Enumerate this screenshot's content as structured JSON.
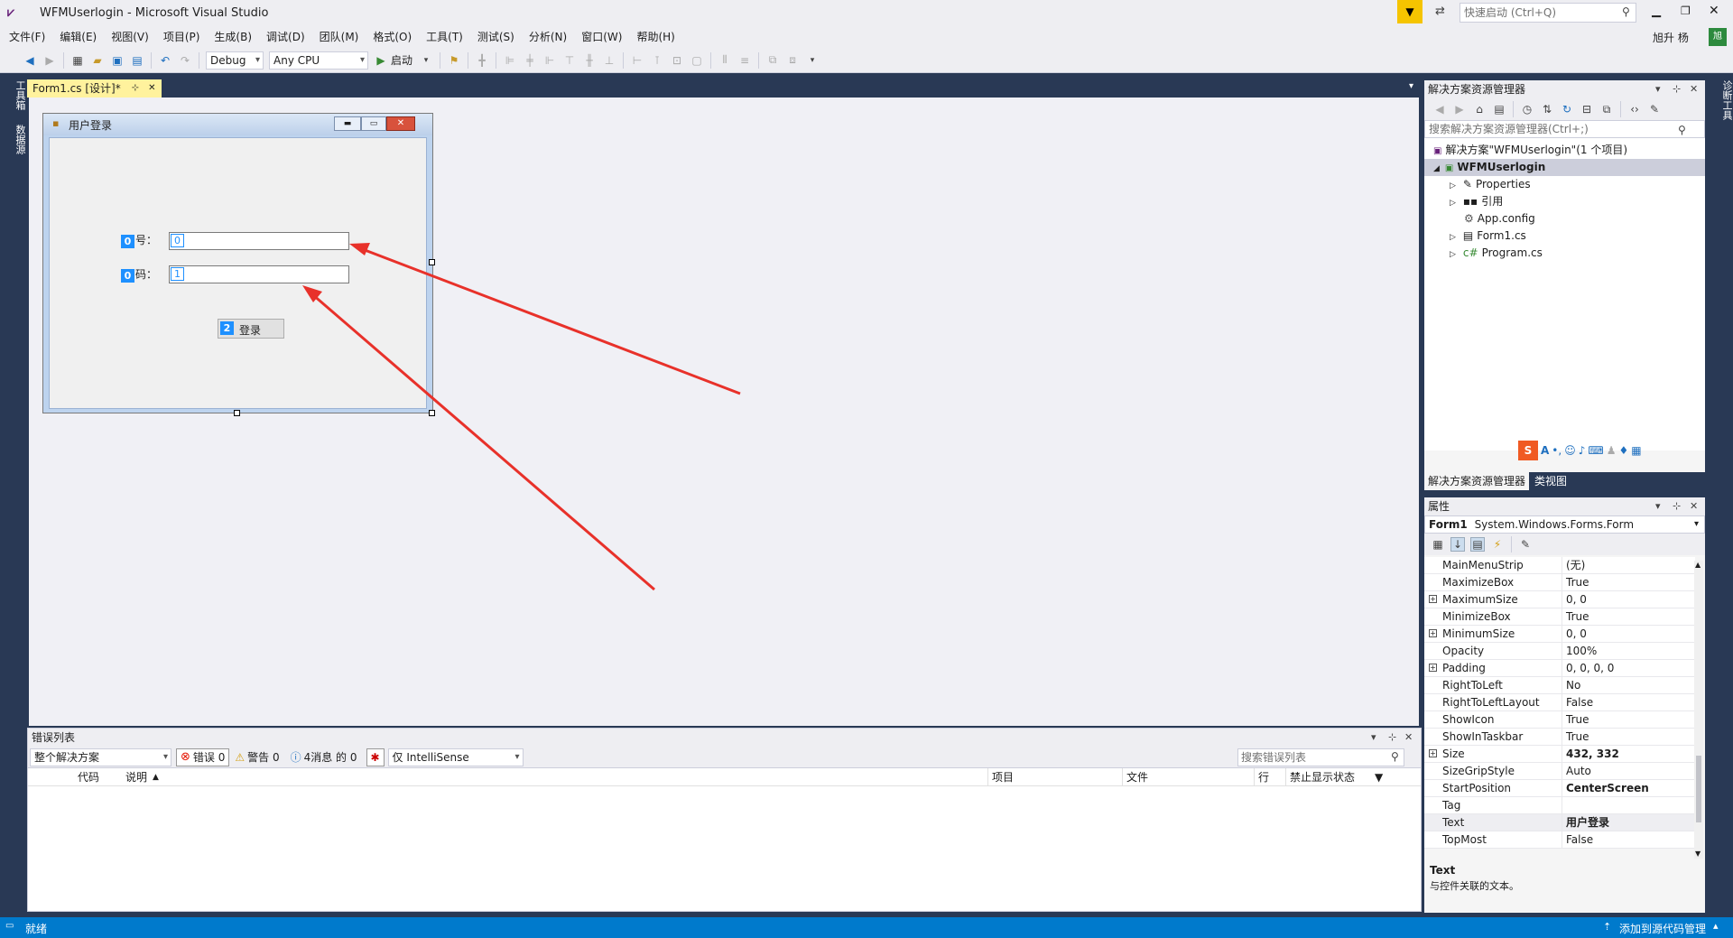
{
  "window": {
    "title": "WFMUserlogin - Microsoft Visual Studio",
    "quick_launch_placeholder": "快速启动 (Ctrl+Q)",
    "user": "旭升 杨"
  },
  "menu": [
    "文件(F)",
    "编辑(E)",
    "视图(V)",
    "项目(P)",
    "生成(B)",
    "调试(D)",
    "团队(M)",
    "格式(O)",
    "工具(T)",
    "测试(S)",
    "分析(N)",
    "窗口(W)",
    "帮助(H)"
  ],
  "toolbar": {
    "config": "Debug",
    "platform": "Any CPU",
    "start_label": "启动"
  },
  "left_strip": [
    "工具箱",
    "数据源"
  ],
  "right_strip": [
    "诊断工具"
  ],
  "doc_tab": {
    "label": "Form1.cs [设计]*",
    "pin": "⊹",
    "close": "✕"
  },
  "form": {
    "title": "用户登录",
    "label1": "号：",
    "label2": "码：",
    "tab_index_labels": [
      "0",
      "0"
    ],
    "textbox1_tab": "0",
    "textbox2_tab": "1",
    "button_tab": "2",
    "button_label": "登录"
  },
  "error_list": {
    "title": "错误列表",
    "scope": "整个解决方案",
    "errors": "错误 0",
    "warnings": "警告 0",
    "messages": "4消息 的 0",
    "filter": "仅 IntelliSense",
    "search_placeholder": "搜索错误列表",
    "columns": [
      "代码",
      "说明",
      "项目",
      "文件",
      "行",
      "禁止显示状态"
    ]
  },
  "solution_explorer": {
    "title": "解决方案资源管理器",
    "search_placeholder": "搜索解决方案资源管理器(Ctrl+;)",
    "solution": "解决方案\"WFMUserlogin\"(1 个项目)",
    "project": "WFMUserlogin",
    "items": [
      "Properties",
      "引用",
      "App.config",
      "Form1.cs",
      "Program.cs"
    ],
    "bottom_tabs": [
      "解决方案资源管理器",
      "类视图"
    ]
  },
  "properties": {
    "title": "属性",
    "object": "Form1",
    "object_type": "System.Windows.Forms.Form",
    "rows": [
      {
        "name": "MainMenuStrip",
        "value": "(无)",
        "expandable": false,
        "bold": false
      },
      {
        "name": "MaximizeBox",
        "value": "True",
        "expandable": false,
        "bold": false
      },
      {
        "name": "MaximumSize",
        "value": "0, 0",
        "expandable": true,
        "bold": false
      },
      {
        "name": "MinimizeBox",
        "value": "True",
        "expandable": false,
        "bold": false
      },
      {
        "name": "MinimumSize",
        "value": "0, 0",
        "expandable": true,
        "bold": false
      },
      {
        "name": "Opacity",
        "value": "100%",
        "expandable": false,
        "bold": false
      },
      {
        "name": "Padding",
        "value": "0, 0, 0, 0",
        "expandable": true,
        "bold": false
      },
      {
        "name": "RightToLeft",
        "value": "No",
        "expandable": false,
        "bold": false
      },
      {
        "name": "RightToLeftLayout",
        "value": "False",
        "expandable": false,
        "bold": false
      },
      {
        "name": "ShowIcon",
        "value": "True",
        "expandable": false,
        "bold": false
      },
      {
        "name": "ShowInTaskbar",
        "value": "True",
        "expandable": false,
        "bold": false
      },
      {
        "name": "Size",
        "value": "432, 332",
        "expandable": true,
        "bold": true
      },
      {
        "name": "SizeGripStyle",
        "value": "Auto",
        "expandable": false,
        "bold": false
      },
      {
        "name": "StartPosition",
        "value": "CenterScreen",
        "expandable": false,
        "bold": true
      },
      {
        "name": "Tag",
        "value": "",
        "expandable": false,
        "bold": false
      },
      {
        "name": "Text",
        "value": "用户登录",
        "expandable": false,
        "bold": true
      },
      {
        "name": "TopMost",
        "value": "False",
        "expandable": false,
        "bold": false
      }
    ],
    "desc_title": "Text",
    "desc_text": "与控件关联的文本。"
  },
  "status": {
    "left": "就绪",
    "right": "添加到源代码管理"
  },
  "colors": {
    "accent": "#007acc",
    "annotation_arrow": "#e8312a",
    "tab_index_badge": "#1e90ff"
  }
}
